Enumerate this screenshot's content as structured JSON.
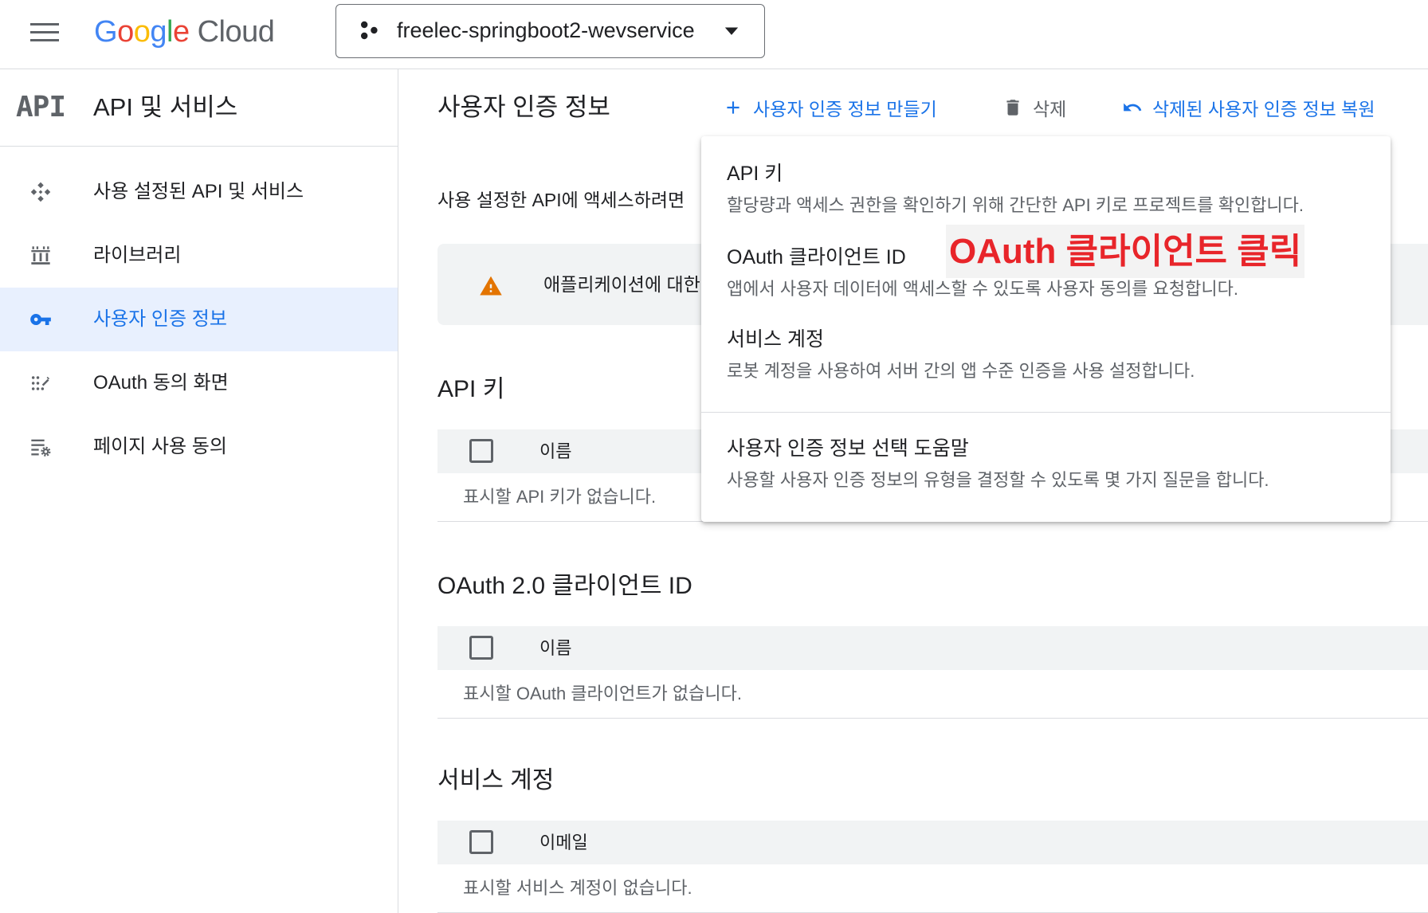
{
  "topbar": {
    "brand_google": "Google",
    "brand_cloud": "Cloud",
    "google_letter_colors": [
      "#4285F4",
      "#EA4335",
      "#FBBC05",
      "#4285F4",
      "#34A853",
      "#EA4335"
    ],
    "project_name": "freelec-springboot2-wevservice",
    "menu_icon": "hamburger-menu-icon",
    "project_icon": "project-icon",
    "project_dropdown_icon": "dropdown-arrow-icon"
  },
  "sidebar": {
    "product_icon_text": "API",
    "title": "API 및 서비스",
    "items": [
      {
        "label": "사용 설정된 API 및 서비스",
        "icon": "enabled-apis-icon",
        "selected": false
      },
      {
        "label": "라이브러리",
        "icon": "library-icon",
        "selected": false
      },
      {
        "label": "사용자 인증 정보",
        "icon": "key-icon",
        "selected": true
      },
      {
        "label": "OAuth 동의 화면",
        "icon": "oauth-consent-icon",
        "selected": false
      },
      {
        "label": "페이지 사용 동의",
        "icon": "page-usage-icon",
        "selected": false
      }
    ]
  },
  "main": {
    "title": "사용자 인증 정보",
    "actions": {
      "create": {
        "label": "사용자 인증 정보 만들기",
        "icon": "plus-icon"
      },
      "delete": {
        "label": "삭제",
        "icon": "trash-icon"
      },
      "restore": {
        "label": "삭제된 사용자 인증 정보 복원",
        "icon": "undo-icon"
      }
    },
    "intro": "사용 설정한 API에 액세스하려면",
    "warning": {
      "text": "애플리케이션에 대한",
      "icon": "warning-icon"
    },
    "sections": [
      {
        "heading": "API 키",
        "column": "이름",
        "empty": "표시할 API 키가 없습니다."
      },
      {
        "heading": "OAuth 2.0 클라이언트 ID",
        "column": "이름",
        "empty": "표시할 OAuth 클라이언트가 없습니다."
      },
      {
        "heading": "서비스 계정",
        "column": "이메일",
        "empty": "표시할 서비스 계정이 없습니다."
      }
    ]
  },
  "create_menu": {
    "items": [
      {
        "title": "API 키",
        "desc": "할당량과 액세스 권한을 확인하기 위해 간단한 API 키로 프로젝트를 확인합니다."
      },
      {
        "title": "OAuth 클라이언트 ID",
        "desc": "앱에서 사용자 데이터에 액세스할 수 있도록 사용자 동의를 요청합니다."
      },
      {
        "title": "서비스 계정",
        "desc": "로봇 계정을 사용하여 서버 간의 앱 수준 인증을 사용 설정합니다."
      },
      {
        "title": "사용자 인증 정보 선택 도움말",
        "desc": "사용할 사용자 인증 정보의 유형을 결정할 수 있도록 몇 가지 질문을 합니다."
      }
    ]
  },
  "annotation": {
    "text": "OAuth 클라이언트 클릭",
    "color": "#e8252a"
  },
  "colors": {
    "accent": "#1a73e8",
    "warning": "#e37400",
    "selected_bg": "#e8f0fe"
  }
}
